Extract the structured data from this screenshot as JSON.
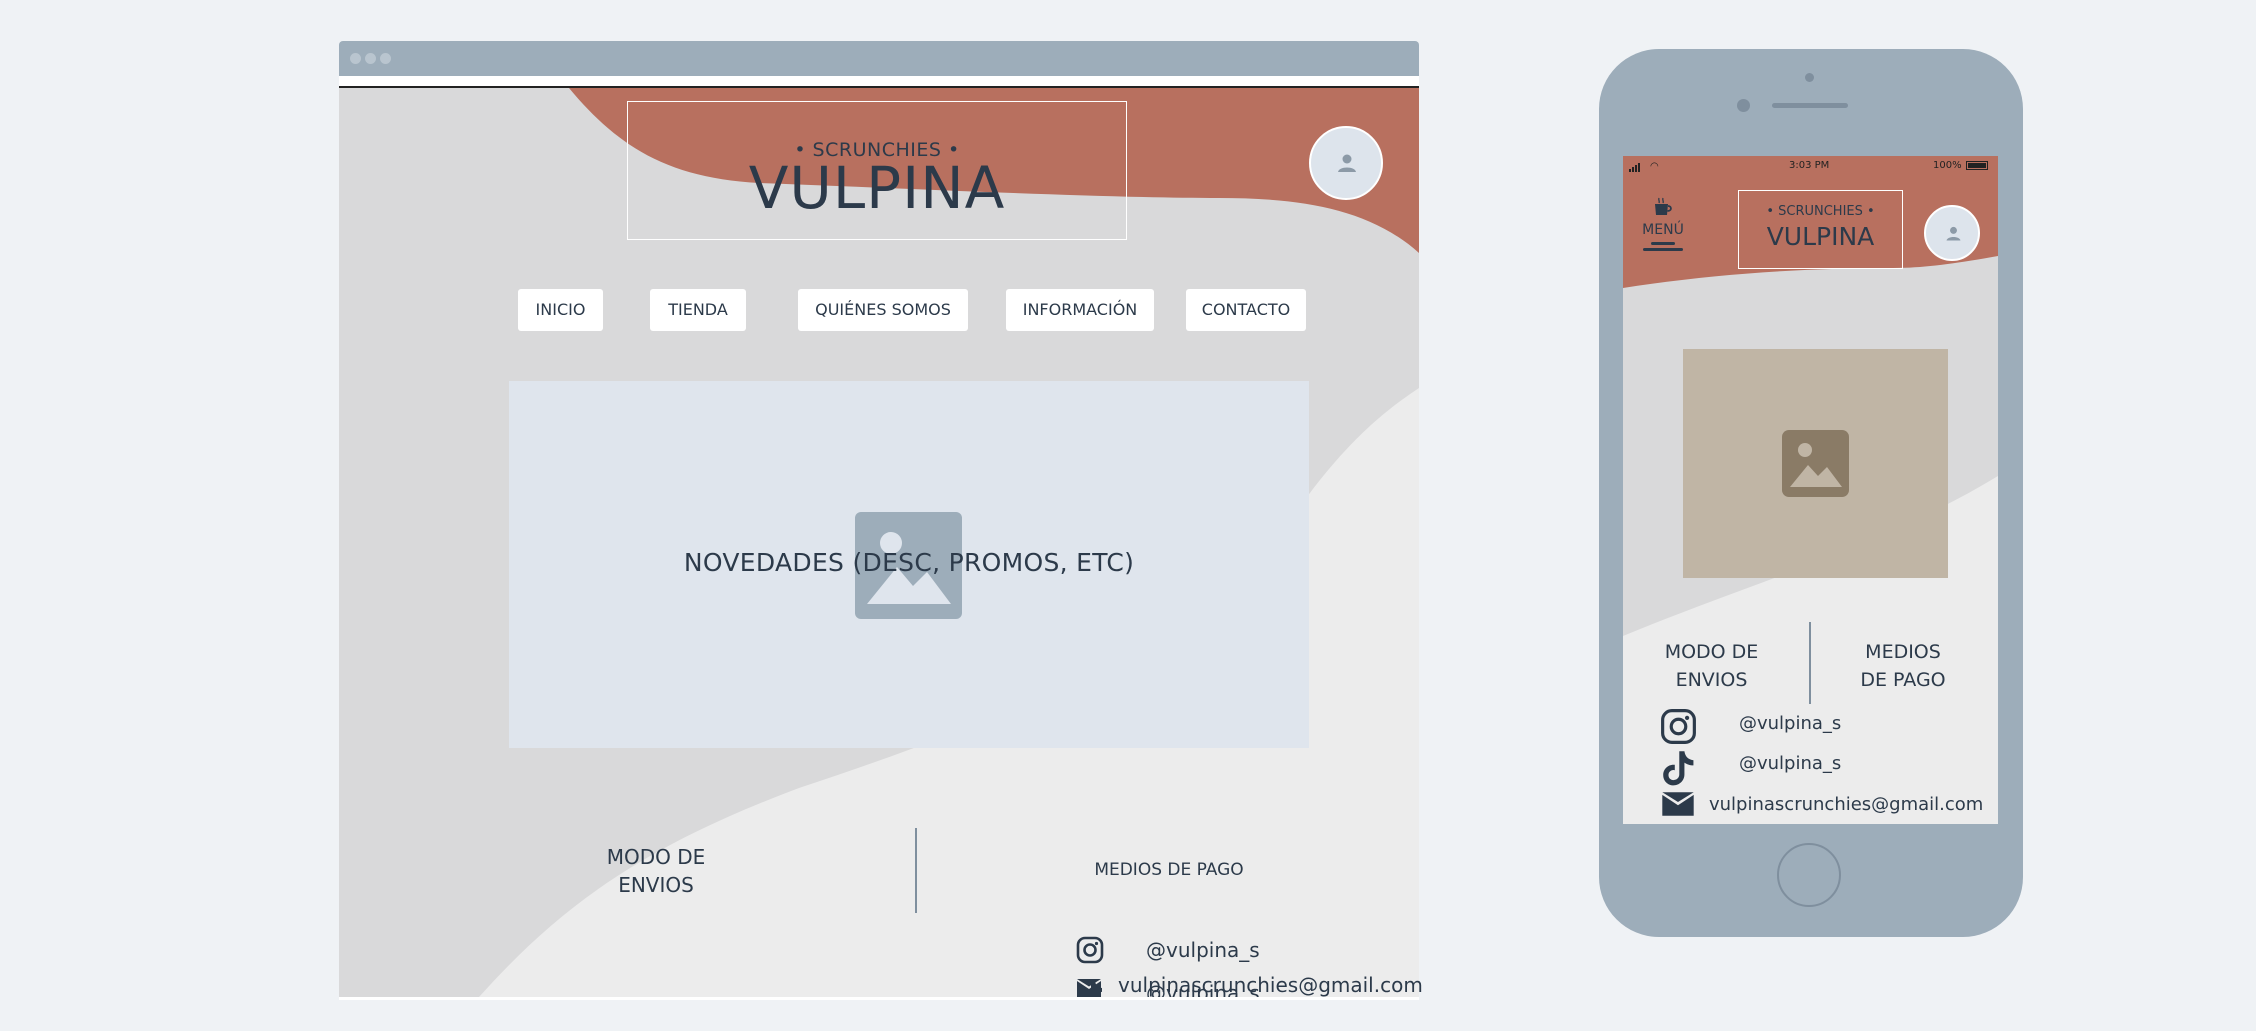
{
  "colors": {
    "page_bg": "#eff2f5",
    "frame": "#9dadba",
    "terracotta": "#b8705f",
    "text_dark": "#2c3a4a",
    "hero_bg": "#dfe5ed",
    "phone_image_bg": "#c0b5a5",
    "phone_image_icon": "#8a7b66"
  },
  "desktop": {
    "brand": {
      "small": "• SCRUNCHIES •",
      "big": "VULPINA"
    },
    "nav": [
      "INICIO",
      "TIENDA",
      "QUIÉNES SOMOS",
      "INFORMACIÓN",
      "CONTACTO"
    ],
    "hero": {
      "title": "NOVEDADES (DESC, PROMOS, ETC)",
      "icon": "image-icon"
    },
    "envios": [
      "MODO DE",
      "ENVIOS"
    ],
    "pagos": "MEDIOS DE PAGO",
    "social": {
      "instagram": "@vulpina_s",
      "tiktok": "@vulpina_s",
      "email": "vulpinascrunchies@gmail.com"
    },
    "user_icon": "user-icon"
  },
  "phone": {
    "status": {
      "time": "3:03 PM",
      "battery": "100%"
    },
    "menu_label": "MENÚ",
    "menu_icon": "coffee-cup-icon",
    "brand": {
      "small": "• SCRUNCHIES •",
      "big": "VULPINA"
    },
    "envios": [
      "MODO DE",
      "ENVIOS"
    ],
    "pagos": [
      "MEDIOS",
      "DE PAGO"
    ],
    "social": {
      "instagram": "@vulpina_s",
      "tiktok": "@vulpina_s",
      "email": "vulpinascrunchies@gmail.com"
    }
  }
}
